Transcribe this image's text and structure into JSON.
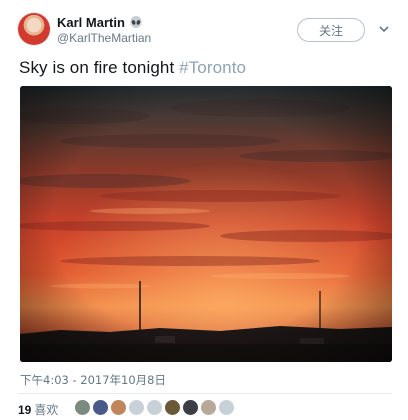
{
  "author": {
    "name": "Karl Martin",
    "handle": "@KarlTheMartian",
    "badge_icon": "alien-emoji-icon"
  },
  "actions": {
    "follow_label": "关注",
    "menu_icon": "chevron-down-icon"
  },
  "tweet": {
    "text": "Sky is on fire tonight ",
    "hashtag": "#Toronto",
    "timestamp": "下午4:03 - 2017年10月8日"
  },
  "engagement": {
    "likes_count": "19",
    "likes_label": "喜欢"
  },
  "likers": [
    {
      "icon": "avatar-icon",
      "color": "#7b8a7e"
    },
    {
      "icon": "avatar-icon",
      "color": "#4a5a8a"
    },
    {
      "icon": "avatar-icon",
      "color": "#c0855a"
    },
    {
      "icon": "avatar-icon",
      "color": "#c8d0d8"
    },
    {
      "icon": "avatar-icon",
      "color": "#c8d0d8"
    },
    {
      "icon": "avatar-icon",
      "color": "#6b5a3a"
    },
    {
      "icon": "avatar-icon",
      "color": "#3a3f47"
    },
    {
      "icon": "avatar-icon",
      "color": "#b8a89a"
    },
    {
      "icon": "avatar-icon",
      "color": "#c8d0d8"
    }
  ],
  "colors": {
    "text": "#14171a",
    "secondary": "#657786",
    "hashtag": "#8fa3b3",
    "divider": "#e6ecf0"
  }
}
